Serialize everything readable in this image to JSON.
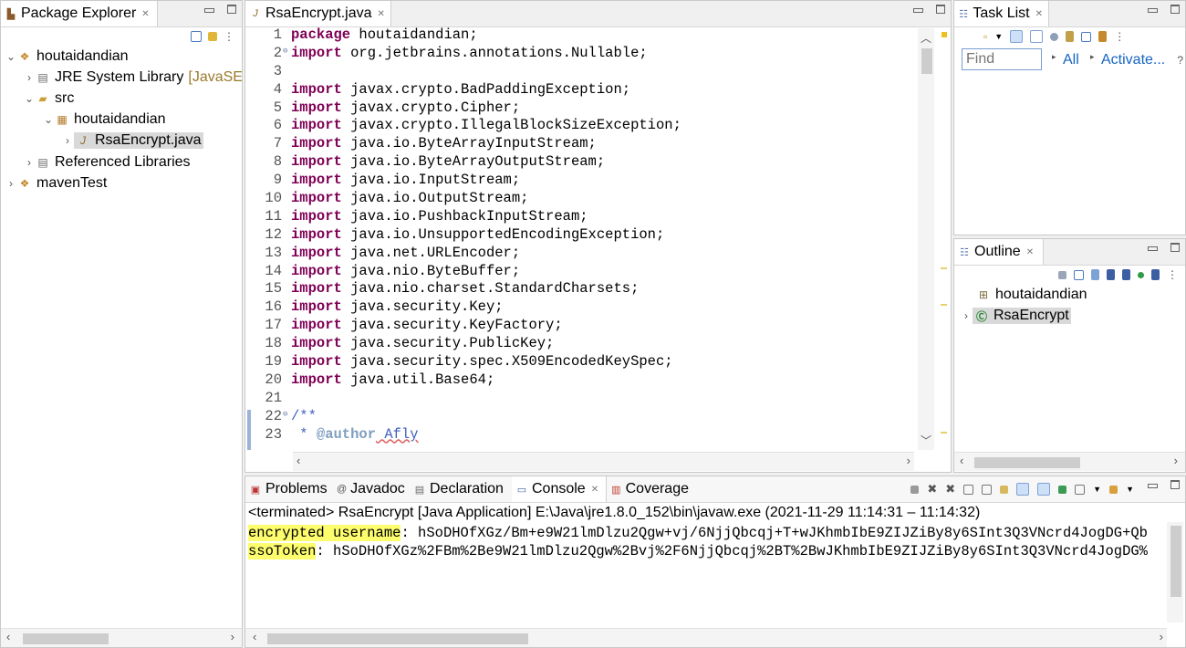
{
  "package_explorer": {
    "title": "Package Explorer",
    "tree": [
      {
        "label": "houtaidandian",
        "icon": "project-icon",
        "twisty": "expanded"
      },
      {
        "label": "JRE System Library",
        "suffix": "[JavaSE",
        "icon": "library-icon",
        "twisty": "collapsed"
      },
      {
        "label": "src",
        "icon": "source-folder-icon",
        "twisty": "expanded"
      },
      {
        "label": "houtaidandian",
        "icon": "package-icon",
        "twisty": "expanded"
      },
      {
        "label": "RsaEncrypt.java",
        "icon": "java-file-icon",
        "twisty": "collapsed"
      },
      {
        "label": "Referenced Libraries",
        "icon": "library-icon",
        "twisty": "collapsed"
      },
      {
        "label": "mavenTest",
        "icon": "project-icon",
        "twisty": "collapsed"
      }
    ]
  },
  "editor": {
    "tab_title": "RsaEncrypt.java",
    "lines": [
      {
        "n": "1",
        "kw": "package",
        "rest": " houtaidandian;"
      },
      {
        "n": "2",
        "kw": "import",
        "rest": " org.jetbrains.annotations.Nullable;",
        "fold": "⊖"
      },
      {
        "n": "3",
        "kw": "",
        "rest": ""
      },
      {
        "n": "4",
        "kw": "import",
        "rest": " javax.crypto.BadPaddingException;"
      },
      {
        "n": "5",
        "kw": "import",
        "rest": " javax.crypto.Cipher;"
      },
      {
        "n": "6",
        "kw": "import",
        "rest": " javax.crypto.IllegalBlockSizeException;"
      },
      {
        "n": "7",
        "kw": "import",
        "rest": " java.io.ByteArrayInputStream;"
      },
      {
        "n": "8",
        "kw": "import",
        "rest": " java.io.ByteArrayOutputStream;"
      },
      {
        "n": "9",
        "kw": "import",
        "rest": " java.io.InputStream;"
      },
      {
        "n": "10",
        "kw": "import",
        "rest": " java.io.OutputStream;"
      },
      {
        "n": "11",
        "kw": "import",
        "rest": " java.io.PushbackInputStream;"
      },
      {
        "n": "12",
        "kw": "import",
        "rest": " java.io.UnsupportedEncodingException;"
      },
      {
        "n": "13",
        "kw": "import",
        "rest": " java.net.URLEncoder;"
      },
      {
        "n": "14",
        "kw": "import",
        "rest": " java.nio.ByteBuffer;"
      },
      {
        "n": "15",
        "kw": "import",
        "rest": " java.nio.charset.StandardCharsets;"
      },
      {
        "n": "16",
        "kw": "import",
        "rest": " java.security.Key;"
      },
      {
        "n": "17",
        "kw": "import",
        "rest": " java.security.KeyFactory;"
      },
      {
        "n": "18",
        "kw": "import",
        "rest": " java.security.PublicKey;"
      },
      {
        "n": "19",
        "kw": "import",
        "rest": " java.security.spec.X509EncodedKeySpec;"
      },
      {
        "n": "20",
        "kw": "import",
        "rest": " java.util.Base64;"
      },
      {
        "n": "21",
        "kw": "",
        "rest": ""
      },
      {
        "n": "22",
        "kw": "",
        "rest": "/**",
        "fold": "⊖",
        "comment": true
      },
      {
        "n": "23",
        "kw": "",
        "rest": " * ",
        "tag": "@author",
        "tagrest": " Afly",
        "comment": true
      }
    ]
  },
  "task_list": {
    "title": "Task List",
    "find_placeholder": "Find",
    "all_label": "All",
    "activate_label": "Activate..."
  },
  "outline": {
    "title": "Outline",
    "items": [
      {
        "label": "houtaidandian",
        "icon": "package-icon"
      },
      {
        "label": "RsaEncrypt",
        "icon": "class-icon"
      }
    ]
  },
  "bottom": {
    "tabs": [
      {
        "label": "Problems",
        "icon": "problems-icon"
      },
      {
        "label": "Javadoc",
        "icon": "javadoc-icon"
      },
      {
        "label": "Declaration",
        "icon": "declaration-icon"
      },
      {
        "label": "Console",
        "icon": "console-icon",
        "active": true
      },
      {
        "label": "Coverage",
        "icon": "coverage-icon"
      }
    ],
    "status": "<terminated> RsaEncrypt [Java Application] E:\\Java\\jre1.8.0_152\\bin\\javaw.exe  (2021-11-29 11:14:31 – 11:14:32)",
    "console": [
      {
        "key": "encrypted username",
        "value": ": hSoDHOfXGz/Bm+e9W21lmDlzu2Qgw+vj/6NjjQbcqj+T+wJKhmbIbE9ZIJZiBy8y6SInt3Q3VNcrd4JogDG+Qb"
      },
      {
        "key": "ssoToken",
        "value": ": hSoDHOfXGz%2FBm%2Be9W21lmDlzu2Qgw%2Bvj%2F6NjjQbcqj%2BT%2BwJKhmbIbE9ZIJZiBy8y6SInt3Q3VNcrd4JogDG%"
      }
    ]
  }
}
